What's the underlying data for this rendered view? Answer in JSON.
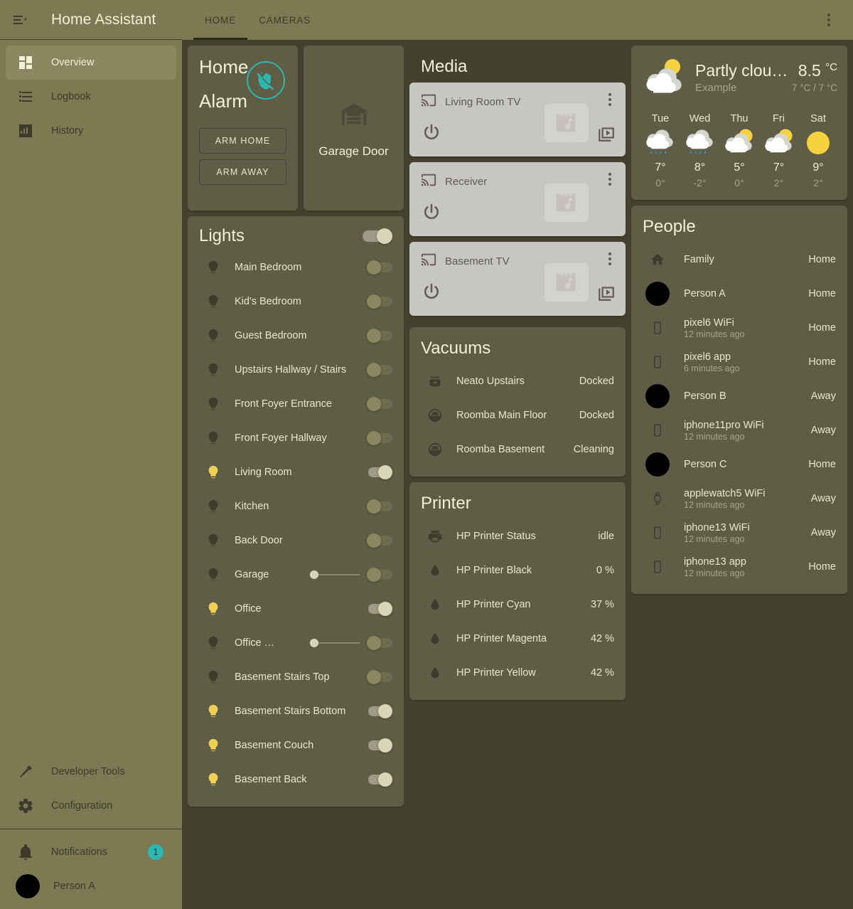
{
  "sidebar": {
    "title": "Home Assistant",
    "nav": [
      {
        "label": "Overview",
        "icon": "view-dashboard-icon",
        "active": true
      },
      {
        "label": "Logbook",
        "icon": "format-list-bulleted-icon",
        "active": false
      },
      {
        "label": "History",
        "icon": "chart-box-icon",
        "active": false
      }
    ],
    "bottom": [
      {
        "label": "Developer Tools",
        "icon": "hammer-wrench-icon"
      },
      {
        "label": "Configuration",
        "icon": "cog-icon"
      }
    ],
    "notifications": {
      "label": "Notifications",
      "icon": "bell-icon",
      "count": "1"
    },
    "user": {
      "label": "Person A",
      "icon": "avatar"
    }
  },
  "topbar": {
    "tabs": [
      {
        "label": "HOME",
        "active": true
      },
      {
        "label": "CAMERAS",
        "active": false
      }
    ],
    "overflow_icon": "dots-vertical-icon"
  },
  "alarm": {
    "state": "Home",
    "name": "Alarm",
    "icon": "shield-off-icon",
    "accent": "#2cb7b0",
    "buttons": [
      {
        "label": "ARM HOME"
      },
      {
        "label": "ARM AWAY"
      }
    ]
  },
  "garage": {
    "name": "Garage Door",
    "icon": "garage-icon"
  },
  "lights": {
    "title": "Lights",
    "master_on": true,
    "items": [
      {
        "name": "Main Bedroom",
        "on": false,
        "slider": null
      },
      {
        "name": "Kid's Bedroom",
        "on": false,
        "slider": null
      },
      {
        "name": "Guest Bedroom",
        "on": false,
        "slider": null
      },
      {
        "name": "Upstairs Hallway / Stairs",
        "on": false,
        "slider": null
      },
      {
        "name": "Front Foyer Entrance",
        "on": false,
        "slider": null
      },
      {
        "name": "Front Foyer Hallway",
        "on": false,
        "slider": null
      },
      {
        "name": "Living Room",
        "on": true,
        "slider": null
      },
      {
        "name": "Kitchen",
        "on": false,
        "slider": null
      },
      {
        "name": "Back Door",
        "on": false,
        "slider": null
      },
      {
        "name": "Garage",
        "on": false,
        "slider": 0
      },
      {
        "name": "Office",
        "on": true,
        "slider": null
      },
      {
        "name": "Office …",
        "on": false,
        "slider": 0
      },
      {
        "name": "Basement Stairs Top",
        "on": false,
        "slider": null
      },
      {
        "name": "Basement Stairs Bottom",
        "on": true,
        "slider": null
      },
      {
        "name": "Basement Couch",
        "on": true,
        "slider": null
      },
      {
        "name": "Basement Back",
        "on": true,
        "slider": null
      }
    ]
  },
  "media": {
    "title": "Media",
    "players": [
      {
        "name": "Living Room TV",
        "icon": "cast-icon",
        "power": true,
        "browse": true
      },
      {
        "name": "Receiver",
        "icon": "cast-icon",
        "power": true,
        "browse": false
      },
      {
        "name": "Basement TV",
        "icon": "cast-icon",
        "power": true,
        "browse": true
      }
    ]
  },
  "vacuums": {
    "title": "Vacuums",
    "items": [
      {
        "name": "Neato Upstairs",
        "state": "Docked",
        "icon": "robot-vacuum-variant-icon"
      },
      {
        "name": "Roomba Main Floor",
        "state": "Docked",
        "icon": "robot-vacuum-icon"
      },
      {
        "name": "Roomba Basement",
        "state": "Cleaning",
        "icon": "robot-vacuum-icon"
      }
    ]
  },
  "printer": {
    "title": "Printer",
    "items": [
      {
        "name": "HP Printer Status",
        "state": "idle",
        "icon": "printer-icon"
      },
      {
        "name": "HP Printer Black",
        "state": "0 %",
        "icon": "water-icon"
      },
      {
        "name": "HP Printer Cyan",
        "state": "37 %",
        "icon": "water-icon"
      },
      {
        "name": "HP Printer Magenta",
        "state": "42 %",
        "icon": "water-icon"
      },
      {
        "name": "HP Printer Yellow",
        "state": "42 %",
        "icon": "water-icon"
      }
    ]
  },
  "weather": {
    "condition": "Partly clou…",
    "entity": "Example",
    "temperature": "8.5",
    "unit": "°C",
    "high_low": "7 °C / 7 °C",
    "icon": "partly-cloudy-icon",
    "forecast": [
      {
        "day": "Tue",
        "icon": "rainy-icon",
        "high": "7°",
        "low": "0°"
      },
      {
        "day": "Wed",
        "icon": "rainy-icon",
        "high": "8°",
        "low": "-2°"
      },
      {
        "day": "Thu",
        "icon": "partly-cloudy-icon",
        "high": "5°",
        "low": "0°"
      },
      {
        "day": "Fri",
        "icon": "partly-cloudy-icon",
        "high": "7°",
        "low": "2°"
      },
      {
        "day": "Sat",
        "icon": "sunny-icon",
        "high": "9°",
        "low": "2°"
      }
    ]
  },
  "people": {
    "title": "People",
    "items": [
      {
        "name": "Family",
        "sub": "",
        "state": "Home",
        "icon": "home-icon"
      },
      {
        "name": "Person A",
        "sub": "",
        "state": "Home",
        "icon": "avatar"
      },
      {
        "name": "pixel6 WiFi",
        "sub": "12 minutes ago",
        "state": "Home",
        "icon": "cellphone-icon"
      },
      {
        "name": "pixel6 app",
        "sub": "6 minutes ago",
        "state": "Home",
        "icon": "cellphone-icon"
      },
      {
        "name": "Person B",
        "sub": "",
        "state": "Away",
        "icon": "avatar"
      },
      {
        "name": "iphone11pro WiFi",
        "sub": "12 minutes ago",
        "state": "Away",
        "icon": "cellphone-icon"
      },
      {
        "name": "Person C",
        "sub": "",
        "state": "Home",
        "icon": "avatar"
      },
      {
        "name": "applewatch5 WiFi",
        "sub": "12 minutes ago",
        "state": "Away",
        "icon": "watch-icon"
      },
      {
        "name": "iphone13 WiFi",
        "sub": "12 minutes ago",
        "state": "Away",
        "icon": "cellphone-icon"
      },
      {
        "name": "iphone13 app",
        "sub": "12 minutes ago",
        "state": "Home",
        "icon": "cellphone-icon"
      }
    ]
  }
}
